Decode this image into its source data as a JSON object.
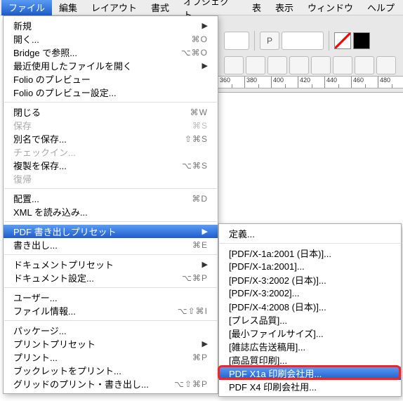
{
  "menubar": {
    "items": [
      {
        "label": "ファイル",
        "active": true
      },
      {
        "label": "編集"
      },
      {
        "label": "レイアウト"
      },
      {
        "label": "書式"
      },
      {
        "label": "オブジェクト"
      },
      {
        "label": "表"
      },
      {
        "label": "表示"
      },
      {
        "label": "ウィンドウ"
      },
      {
        "label": "ヘルプ"
      }
    ]
  },
  "ruler": {
    "ticks": [
      "360",
      "380",
      "400",
      "420",
      "440",
      "460",
      "480"
    ]
  },
  "toolbar": {
    "p_glyph": "P"
  },
  "mainMenu": {
    "groups": [
      [
        {
          "label": "新規",
          "sub": true
        },
        {
          "label": "開く...",
          "shortcut": "⌘O"
        },
        {
          "label": "Bridge で参照...",
          "shortcut": "⌥⌘O"
        },
        {
          "label": "最近使用したファイルを開く",
          "sub": true
        },
        {
          "label": "Folio のプレビュー"
        },
        {
          "label": "Folio のプレビュー設定..."
        }
      ],
      [
        {
          "label": "閉じる",
          "shortcut": "⌘W"
        },
        {
          "label": "保存",
          "shortcut": "⌘S",
          "disabled": true
        },
        {
          "label": "別名で保存...",
          "shortcut": "⇧⌘S"
        },
        {
          "label": "チェックイン...",
          "disabled": true
        },
        {
          "label": "複製を保存...",
          "shortcut": "⌥⌘S"
        },
        {
          "label": "復帰",
          "disabled": true
        }
      ],
      [
        {
          "label": "配置...",
          "shortcut": "⌘D"
        },
        {
          "label": "XML を読み込み..."
        }
      ],
      [
        {
          "label": "PDF 書き出しプリセット",
          "sub": true,
          "highlight": true
        },
        {
          "label": "書き出し...",
          "shortcut": "⌘E"
        }
      ],
      [
        {
          "label": "ドキュメントプリセット",
          "sub": true
        },
        {
          "label": "ドキュメント設定...",
          "shortcut": "⌥⌘P"
        }
      ],
      [
        {
          "label": "ユーザー..."
        },
        {
          "label": "ファイル情報...",
          "shortcut": "⌥⇧⌘I"
        }
      ],
      [
        {
          "label": "パッケージ..."
        },
        {
          "label": "プリントプリセット",
          "sub": true
        },
        {
          "label": "プリント...",
          "shortcut": "⌘P"
        },
        {
          "label": "ブックレットをプリント..."
        },
        {
          "label": "グリッドのプリント・書き出し...",
          "shortcut": "⌥⇧⌘P"
        }
      ]
    ]
  },
  "subMenu": {
    "groups": [
      [
        {
          "label": "定義..."
        }
      ],
      [
        {
          "label": "[PDF/X-1a:2001 (日本)]..."
        },
        {
          "label": "[PDF/X-1a:2001]..."
        },
        {
          "label": "[PDF/X-3:2002 (日本)]..."
        },
        {
          "label": "[PDF/X-3:2002]..."
        },
        {
          "label": "[PDF/X-4:2008 (日本)]..."
        },
        {
          "label": "[プレス品質]..."
        },
        {
          "label": "[最小ファイルサイズ]..."
        },
        {
          "label": "[雑誌広告送稿用]..."
        },
        {
          "label": "[高品質印刷]..."
        },
        {
          "label": "PDF X1a 印刷会社用...",
          "highlight": true,
          "outlined": true
        },
        {
          "label": "PDF X4 印刷会社用..."
        }
      ]
    ]
  }
}
